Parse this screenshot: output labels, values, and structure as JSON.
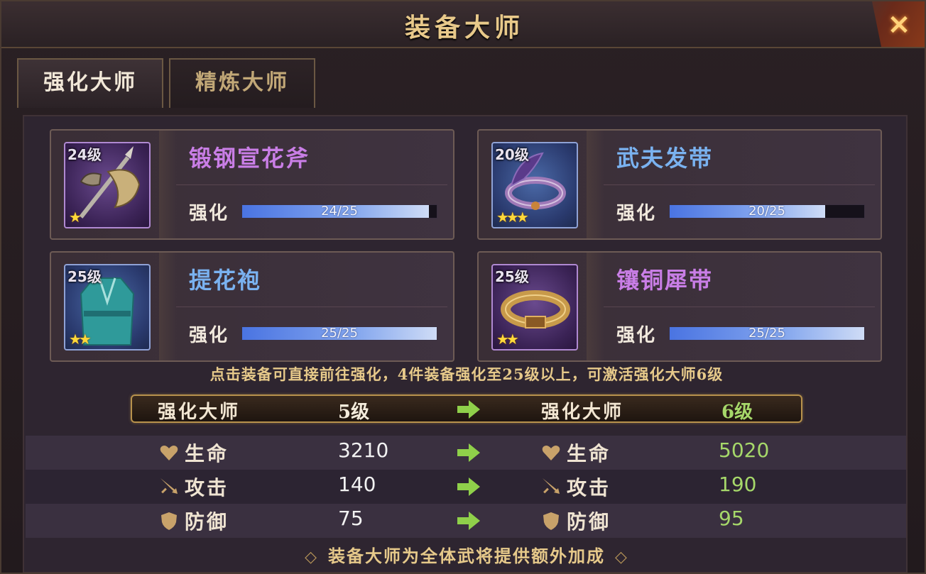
{
  "window": {
    "title": "装备大师",
    "close_icon": "×"
  },
  "tabs": [
    {
      "label": "强化大师",
      "active": true
    },
    {
      "label": "精炼大师",
      "active": false
    }
  ],
  "equipment": [
    {
      "level": "24级",
      "name": "锻钢宣花斧",
      "stars": "★",
      "rarity": "purple",
      "stat_label": "强化",
      "progress_text": "24/25",
      "progress": 0.96,
      "icon": "axe-icon"
    },
    {
      "level": "20级",
      "name": "武夫发带",
      "stars": "★★★",
      "rarity": "blue",
      "stat_label": "强化",
      "progress_text": "20/25",
      "progress": 0.8,
      "icon": "headband-icon"
    },
    {
      "level": "25级",
      "name": "提花袍",
      "stars": "★★",
      "rarity": "blue",
      "stat_label": "强化",
      "progress_text": "25/25",
      "progress": 1.0,
      "icon": "robe-icon"
    },
    {
      "level": "25级",
      "name": "镶铜犀带",
      "stars": "★★",
      "rarity": "purple",
      "stat_label": "强化",
      "progress_text": "25/25",
      "progress": 1.0,
      "icon": "belt-icon"
    }
  ],
  "hint": "点击装备可直接前往强化，4件装备强化至25级以上，可激活强化大师6级",
  "master": {
    "current_label": "强化大师",
    "current_level": "5级",
    "next_label": "强化大师",
    "next_level": "6级"
  },
  "stats": [
    {
      "label": "生命",
      "icon": "heart-icon",
      "current": "3210",
      "next": "5020"
    },
    {
      "label": "攻击",
      "icon": "sword-icon",
      "current": "140",
      "next": "190"
    },
    {
      "label": "防御",
      "icon": "shield-icon",
      "current": "75",
      "next": "95"
    }
  ],
  "footer": "装备大师为全体武将提供额外加成",
  "colors": {
    "accent_gold": "#e8c98a",
    "purple_name": "#c97ee6",
    "blue_name": "#7ab2f0",
    "green_value": "#a6d86a"
  }
}
